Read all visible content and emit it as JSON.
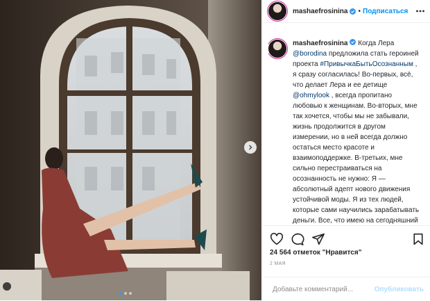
{
  "post": {
    "username": "mashaefrosinina",
    "follow_label": "Подписаться",
    "separator": "•",
    "likes_text": "24 564 отметок \"Нравится\"",
    "date": "2 МАЯ"
  },
  "caption": {
    "t1": " Когда Лера ",
    "mention1": "@borodina",
    "t2": " предложила стать героиней проекта ",
    "hashtag": "#ПривычкаБытьОсознанным",
    "t3": " , я сразу согласилась! Во-первых, всё, что делает Лера и ее детище ",
    "mention2": "@ohmylook",
    "t4": " , всегда пропитано любовью к женщинам. Во-вторых, мне так хочется, чтобы мы не забывали, жизнь продолжится в другом измерении, но в ней всегда должно остаться место красоте и взаимоподдержке. В-третьих, мне сильно перестраиваться на осознанность не нужно: Я — абсолютный адепт нового движения устойчивой моды. Я из тех людей, которые сами научились зарабатывать деньги. Все, что имею на сегодняшний день, заработала"
  },
  "comment": {
    "placeholder": "Добавьте комментарий...",
    "publish_label": "Опубликовать"
  },
  "icons": {
    "verified": "verified-badge-icon",
    "more": "more-options-icon",
    "like": "heart-icon",
    "comment": "comment-icon",
    "share": "share-icon",
    "save": "bookmark-icon",
    "next": "chevron-right-icon"
  },
  "colors": {
    "accent": "#0095f6",
    "verified": "#3897f0",
    "link": "#00376b",
    "muted": "#8e8e8e"
  },
  "carousel": {
    "slides": 3,
    "active": 1
  }
}
